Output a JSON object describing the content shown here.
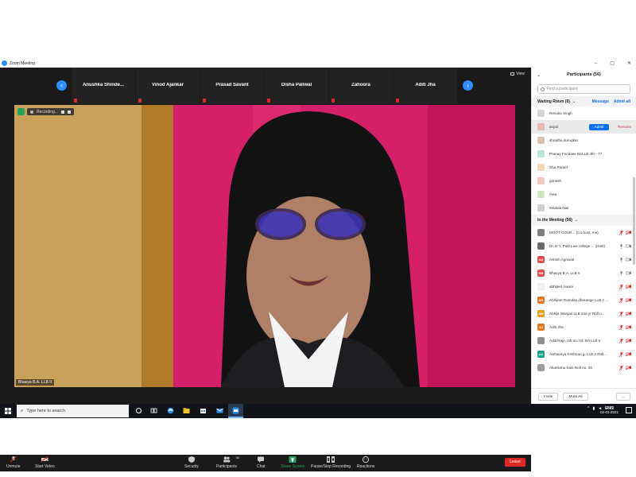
{
  "window": {
    "title": "Zoom Meeting"
  },
  "gallery_strip": {
    "participants": [
      "Anushka  Shinde...",
      "Vinod Ajankar",
      "Prasad Savant",
      "Disha Paliwal",
      "Zahoora",
      "Aditi Jha"
    ],
    "view_label": "View"
  },
  "video": {
    "recording_label": "Recording...",
    "speaker_name": "Bhavya B.A. LLB II"
  },
  "toolbar": {
    "unmute": "Unmute",
    "start_video": "Start Video",
    "security": "Security",
    "participants": "Participants",
    "participants_count": "56",
    "chat": "Chat",
    "share_screen": "Share Screen",
    "pause_stop_recording": "Pause/Stop Recording",
    "reactions": "Reactions",
    "leave": "Leave"
  },
  "panel": {
    "title": "Participants (56)",
    "search_placeholder": "Find a participant",
    "waiting_room": {
      "label": "Waiting Room (8)",
      "message": "Message",
      "admit_all": "Admit all",
      "admit": "Admit",
      "remove": "Remove",
      "people": [
        {
          "name": "Renuka Singh",
          "color": "#d7d7d7"
        },
        {
          "name": "anjali",
          "color": "#e8b9b9"
        },
        {
          "name": "shradha durugkar",
          "color": "#d9c4b8"
        },
        {
          "name": "Pranay Fondase BALLB 4th - 77",
          "color": "#bfe3d9"
        },
        {
          "name": "Sha Pareet",
          "color": "#f3d9b8"
        },
        {
          "name": "ganesh",
          "color": "#f2c9c0"
        },
        {
          "name": "rhea",
          "color": "#c8e6c0"
        },
        {
          "name": "Mridula Nair",
          "color": "#cfcfcf"
        }
      ]
    },
    "in_meeting": {
      "label": "In the Meeting (56)",
      "people": [
        {
          "initials": "",
          "name": "MOOT COUR...  (Co-host, me)",
          "color": "#7d7d7d",
          "mic_muted": true,
          "cam_off": true
        },
        {
          "initials": "",
          "name": "Dr. D.Y. Patil Law college ... (Host)",
          "color": "#6a6a6a",
          "mic_muted": false,
          "cam_off": false
        },
        {
          "initials": "AA",
          "name": "Ashish Agrawal",
          "color": "#e34d4d",
          "mic_muted": false,
          "cam_off": false
        },
        {
          "initials": "BB",
          "name": "Bhavya B.A. LLB II",
          "color": "#e34d4d",
          "mic_muted": false,
          "cam_off": false
        },
        {
          "initials": "",
          "name": "abhijeet Aware",
          "color": "#eeeeee",
          "mic_muted": true,
          "cam_off": true
        },
        {
          "initials": "AR",
          "name": "Abhijeet Ramdas dherange LLB 2 ...",
          "color": "#e3741f",
          "mic_muted": true,
          "cam_off": true
        },
        {
          "initials": "AW",
          "name": "Abhijit Wanjari LLB 2nd yr Roll n...",
          "color": "#e3a01f",
          "mic_muted": true,
          "cam_off": true
        },
        {
          "initials": "AJ",
          "name": "Aditi Jha",
          "color": "#e3741f",
          "mic_muted": true,
          "cam_off": true
        },
        {
          "initials": "",
          "name": "Aditi Raje, roll no. 03, BA LLB II",
          "color": "#8e8e8e",
          "mic_muted": true,
          "cam_off": true
        },
        {
          "initials": "AK",
          "name": "Aishwarya Krishnan g, LLB 2 Roll...",
          "color": "#16a085",
          "mic_muted": true,
          "cam_off": true
        },
        {
          "initials": "",
          "name": "Akanksha Kale Roll no. 06",
          "color": "#9e9e9e",
          "mic_muted": true,
          "cam_off": true
        }
      ]
    },
    "invite": "Invite",
    "mute_all": "Mute All",
    "more": "..."
  },
  "taskbar": {
    "search_placeholder": "Type here to search",
    "lang": "ENG",
    "time": "11:35",
    "date": "02-01-2021"
  },
  "colors": {
    "zoom_blue": "#2d8cff",
    "leave_red": "#e02828",
    "share_green": "#23a35a"
  }
}
